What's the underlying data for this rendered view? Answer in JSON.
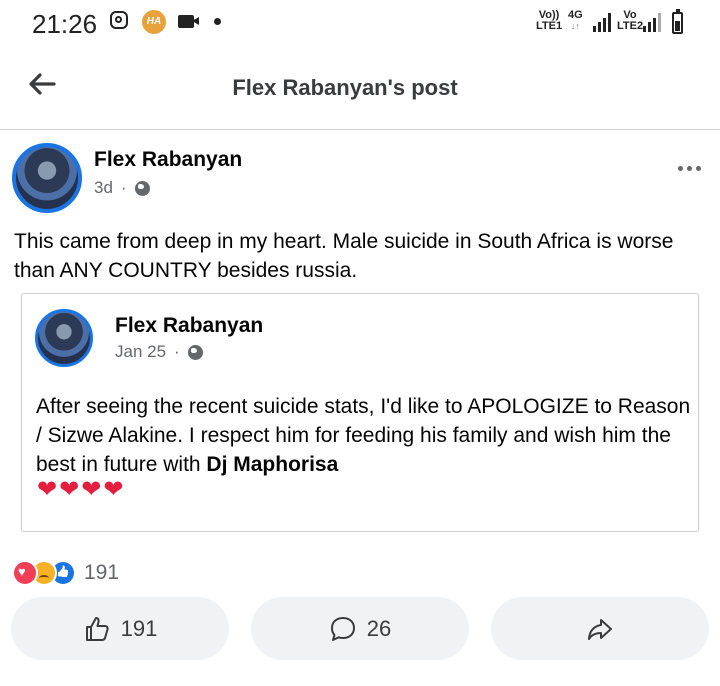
{
  "status_bar": {
    "time": "21:26",
    "app_badge": "HA",
    "sim1": {
      "top": "Vo))",
      "bottom": "LTE1",
      "network": "4G"
    },
    "sim2": {
      "top": "Vo",
      "bottom": "LTE2"
    }
  },
  "header": {
    "title": "Flex Rabanyan's post"
  },
  "post": {
    "author": "Flex Rabanyan",
    "time": "3d",
    "separator": "·",
    "text": "This came from deep in my heart. Male suicide in South Africa is worse than ANY COUNTRY besides russia."
  },
  "shared_post": {
    "author": "Flex Rabanyan",
    "time": "Jan 25",
    "separator": "·",
    "text_before": "After seeing the recent suicide stats, I'd like to APOLOGIZE to Reason / Sizwe Alakine. I respect him for feeding his family and wish him the best in future with ",
    "text_bold": "Dj Maphorisa",
    "hearts": "❤❤❤❤"
  },
  "reactions": {
    "count": "191",
    "types": [
      "love-icon",
      "sad-icon",
      "like-icon"
    ]
  },
  "actions": {
    "like_count": "191",
    "comment_count": "26"
  },
  "colors": {
    "accent": "#1b74e4",
    "heart": "#e41e3f",
    "button_bg": "#f0f2f5",
    "secondary_text": "#65676b"
  }
}
